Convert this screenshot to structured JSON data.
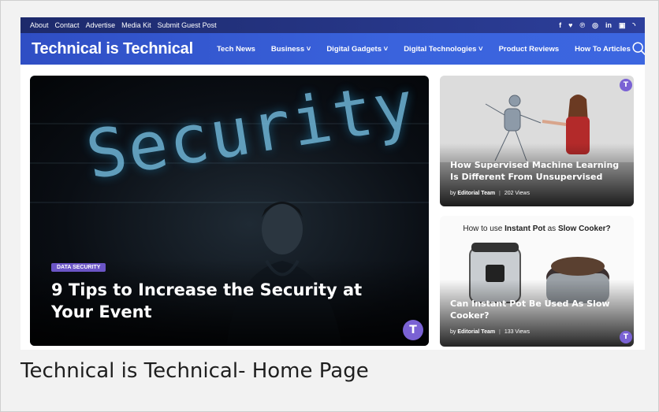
{
  "topbar": {
    "links": [
      "About",
      "Contact",
      "Advertise",
      "Media Kit",
      "Submit Guest Post"
    ],
    "social_icons": [
      "facebook-icon",
      "twitter-icon",
      "pinterest-icon",
      "instagram-icon",
      "linkedin-icon",
      "youtube-icon",
      "rss-icon"
    ]
  },
  "navbar": {
    "logo": "Technical is Technical",
    "items": [
      {
        "label": "Tech News",
        "dropdown": false
      },
      {
        "label": "Business ˅",
        "dropdown": true
      },
      {
        "label": "Digital Gadgets ˅",
        "dropdown": true
      },
      {
        "label": "Digital Technologies ˅",
        "dropdown": true
      },
      {
        "label": "Product Reviews",
        "dropdown": false
      },
      {
        "label": "How To Articles",
        "dropdown": false
      }
    ],
    "search_icon": "search-icon"
  },
  "hero": {
    "image_text": "Security",
    "tag": "DATA SECURITY",
    "title": "9 Tips to Increase the Security at Your Event",
    "badge": "T"
  },
  "side_posts": [
    {
      "title": "How Supervised Machine Learning Is Different From Unsupervised",
      "author_prefix": "by",
      "author": "Editorial Team",
      "views": "202 Views",
      "badge": "T"
    },
    {
      "image_caption_prefix": "How to use",
      "image_caption_bold1": "Instant Pot",
      "image_caption_mid": "as",
      "image_caption_bold2": "Slow Cooker?",
      "title": "Can Instant Pot Be Used As Slow Cooker?",
      "author_prefix": "by",
      "author": "Editorial Team",
      "views": "133 Views",
      "badge": "T"
    }
  ],
  "caption": "Technical is Technical- Home Page",
  "colors": {
    "topbar": "#1d2a6b",
    "navbar": "#3a63dd",
    "tag": "#6b55c6",
    "badge": "#7a62d4"
  }
}
